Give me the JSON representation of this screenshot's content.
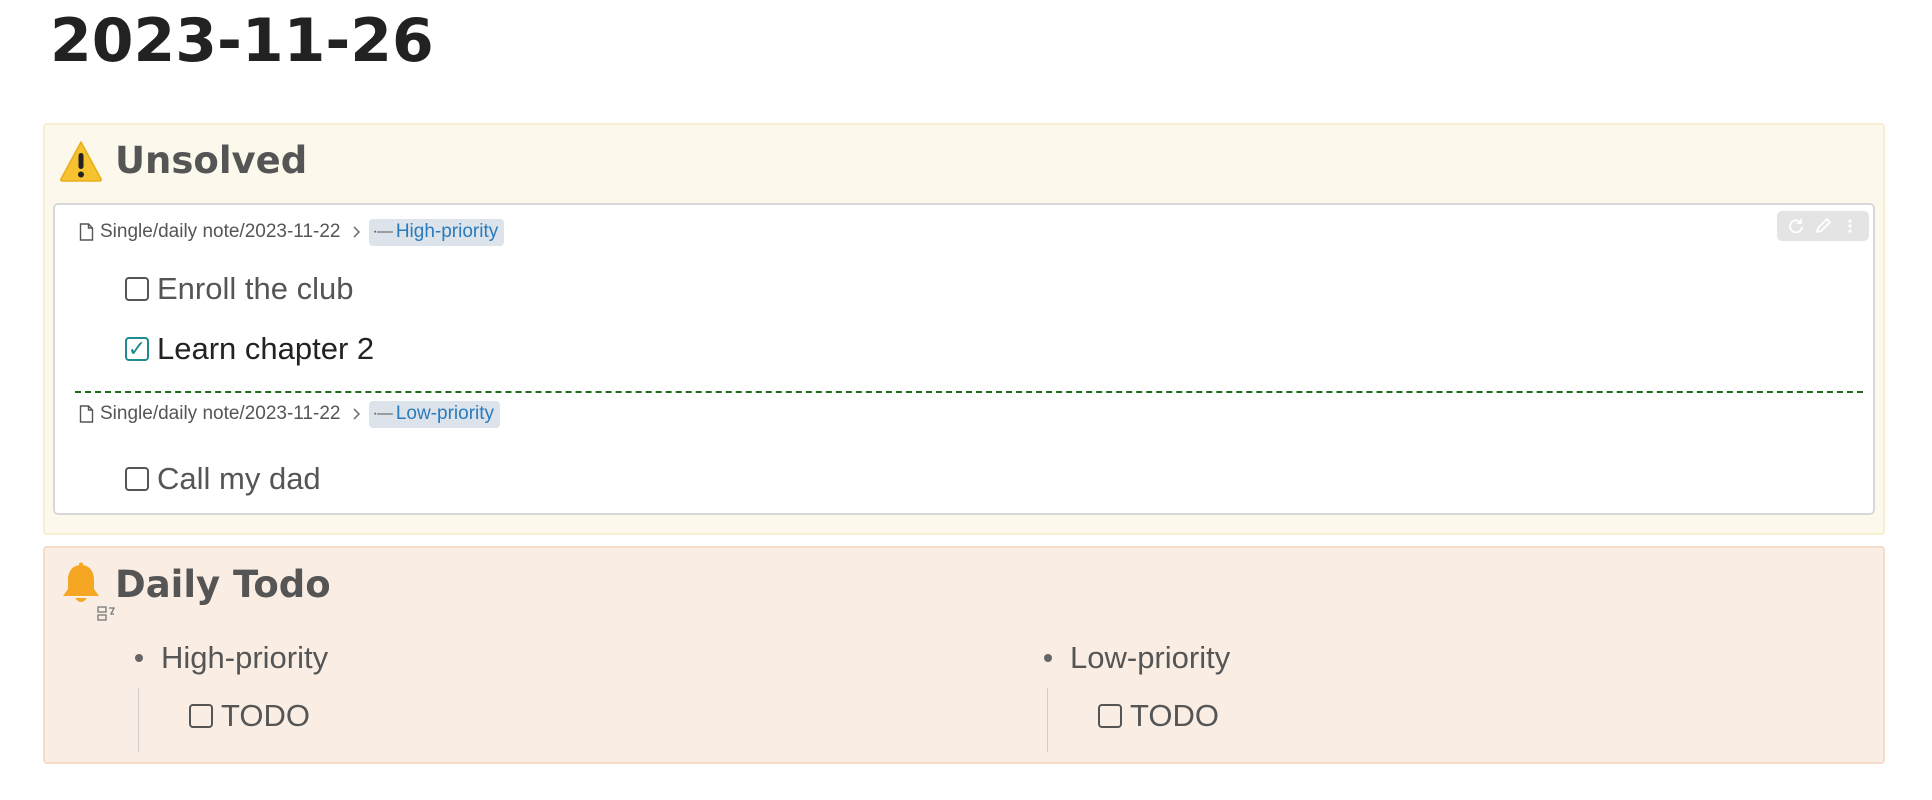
{
  "page": {
    "title": "2023-11-26"
  },
  "unsolved": {
    "icon": "warning-icon",
    "title": "Unsolved",
    "toolbar": {
      "refresh_icon": "refresh-icon",
      "edit_icon": "pencil-icon",
      "more_icon": "more-vertical-icon"
    },
    "groups": [
      {
        "path": "Single/daily note/2023-11-22",
        "heading_glyph": "·—",
        "heading": "High-priority",
        "tasks": [
          {
            "label": "Enroll the club",
            "checked": false
          },
          {
            "label": "Learn chapter 2",
            "checked": true
          }
        ]
      },
      {
        "path": "Single/daily note/2023-11-22",
        "heading_glyph": "·—",
        "heading": "Low-priority",
        "tasks": [
          {
            "label": "Call my dad",
            "checked": false
          }
        ]
      }
    ]
  },
  "daily_todo": {
    "icon": "bell-icon",
    "title": "Daily Todo",
    "columns": [
      {
        "label": "High-priority",
        "tasks": [
          {
            "label": "TODO",
            "checked": false
          }
        ]
      },
      {
        "label": "Low-priority",
        "tasks": [
          {
            "label": "TODO",
            "checked": false
          }
        ]
      }
    ]
  },
  "colors": {
    "unsolved_bg": "#fcf8ec",
    "daily_bg": "#faeee4",
    "link": "#2a7bbd",
    "divider": "#1b6d1b",
    "checked": "#1e8c8c",
    "warning": "#f6c230",
    "bell": "#f5a623"
  }
}
